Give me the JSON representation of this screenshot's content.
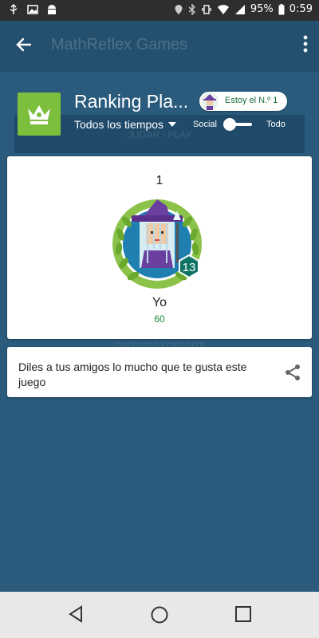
{
  "status_bar": {
    "battery": "95%",
    "time": "0:59"
  },
  "app_bar": {
    "title": "MathReflex Games"
  },
  "background": {
    "play_label": "JUGAR / PLAY",
    "credits_label": "CREDITOS / CREDITS"
  },
  "ranking": {
    "title": "Ranking Pla...",
    "my_rank_chip": "Estoy el N.º 1",
    "time_filter": "Todos los tiempos",
    "toggle_left": "Social",
    "toggle_right": "Todo"
  },
  "player": {
    "rank": "1",
    "level": "13",
    "name": "Yo",
    "score": "60"
  },
  "share_card": {
    "text": "Diles a tus amigos lo mucho que te gusta este juego"
  },
  "colors": {
    "background": "#2a5b7c",
    "app_bar": "#23506e",
    "crown_tile": "#7cbf3d",
    "score_green": "#1e8a3a"
  },
  "icons": [
    "back-arrow-icon",
    "more-vert-icon",
    "crown-icon",
    "share-icon",
    "nav-back-icon",
    "nav-home-icon",
    "nav-recents-icon"
  ]
}
